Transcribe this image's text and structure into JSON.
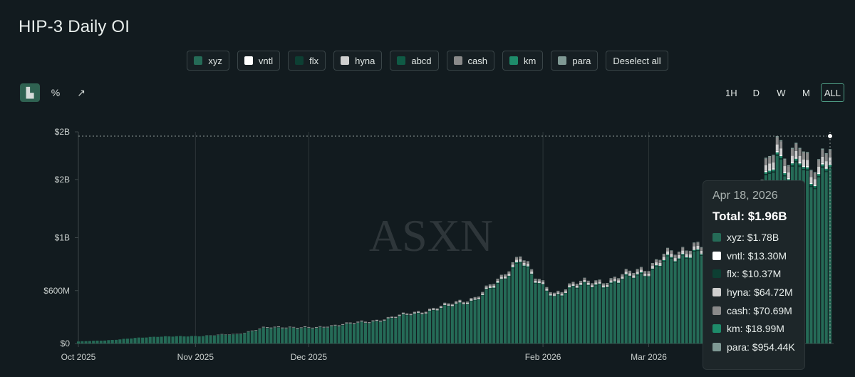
{
  "title": "HIP-3 Daily OI",
  "legend": [
    {
      "name": "xyz",
      "color": "#256b57"
    },
    {
      "name": "vntl",
      "color": "#ffffff"
    },
    {
      "name": "flx",
      "color": "#0d3f33"
    },
    {
      "name": "hyna",
      "color": "#cfcfcf"
    },
    {
      "name": "abcd",
      "color": "#0f5a45"
    },
    {
      "name": "cash",
      "color": "#8a8a8a"
    },
    {
      "name": "km",
      "color": "#1e8b6a"
    },
    {
      "name": "para",
      "color": "#7f9994"
    }
  ],
  "deselect_label": "Deselect all",
  "toolbar": [
    {
      "name": "bar-chart-icon",
      "glyph": "▙",
      "active": true
    },
    {
      "name": "percent-icon",
      "glyph": "%",
      "active": false
    },
    {
      "name": "line-chart-icon",
      "glyph": "↗",
      "active": false
    }
  ],
  "ranges": [
    {
      "label": "1H",
      "active": false
    },
    {
      "label": "D",
      "active": false
    },
    {
      "label": "W",
      "active": false
    },
    {
      "label": "M",
      "active": false
    },
    {
      "label": "ALL",
      "active": true
    }
  ],
  "watermark": "ASXN",
  "tooltip": {
    "date": "Apr 18, 2026",
    "total": "Total: $1.96B",
    "rows": [
      {
        "label": "xyz: $1.78B",
        "color": "#256b57"
      },
      {
        "label": "vntl: $13.30M",
        "color": "#ffffff"
      },
      {
        "label": "flx: $10.37M",
        "color": "#0d3f33"
      },
      {
        "label": "hyna: $64.72M",
        "color": "#cfcfcf"
      },
      {
        "label": "cash: $70.69M",
        "color": "#8a8a8a"
      },
      {
        "label": "km: $18.99M",
        "color": "#1e8b6a"
      },
      {
        "label": "para: $954.44K",
        "color": "#7f9994"
      }
    ]
  },
  "chart_data": {
    "type": "bar",
    "stacked": true,
    "y_ticks": [
      "$2B",
      "$2B",
      "$1B",
      "$600M",
      "$0"
    ],
    "x_ticks": [
      "Oct 2025",
      "Nov 2025",
      "Dec 2025",
      "Feb 2026",
      "Mar 2026"
    ],
    "x_range": [
      "2025-10-01",
      "2026-04-18"
    ],
    "ylim": [
      0,
      2.0
    ],
    "unit": "$B",
    "grid": "vertical month lines",
    "series_order": [
      "xyz",
      "flx",
      "km",
      "vntl",
      "hyna",
      "cash",
      "para"
    ],
    "dates": [
      "2025-10-01",
      "2025-10-08",
      "2025-10-15",
      "2025-10-22",
      "2025-10-29",
      "2025-11-05",
      "2025-11-12",
      "2025-11-19",
      "2025-11-26",
      "2025-12-03",
      "2025-12-10",
      "2025-12-17",
      "2025-12-24",
      "2025-12-31",
      "2026-01-07",
      "2026-01-14",
      "2026-01-21",
      "2026-01-26",
      "2026-01-30",
      "2026-02-04",
      "2026-02-09",
      "2026-02-14",
      "2026-02-19",
      "2026-02-24",
      "2026-03-01",
      "2026-03-05",
      "2026-03-09",
      "2026-03-13",
      "2026-03-17",
      "2026-03-20",
      "2026-03-23",
      "2026-03-26",
      "2026-03-29",
      "2026-04-01",
      "2026-04-04",
      "2026-04-07",
      "2026-04-10",
      "2026-04-13",
      "2026-04-16",
      "2026-04-18"
    ],
    "totals": [
      0.02,
      0.03,
      0.05,
      0.07,
      0.07,
      0.08,
      0.09,
      0.15,
      0.16,
      0.15,
      0.19,
      0.21,
      0.26,
      0.31,
      0.37,
      0.44,
      0.62,
      0.87,
      0.62,
      0.48,
      0.57,
      0.59,
      0.61,
      0.67,
      0.73,
      0.85,
      0.85,
      0.96,
      0.95,
      1.04,
      1.12,
      1.21,
      1.24,
      1.65,
      1.97,
      1.78,
      1.88,
      1.6,
      1.81,
      1.96
    ],
    "tooltip_breakdown_2026_04_18": {
      "xyz": 1.78,
      "vntl": 0.0133,
      "flx": 0.01037,
      "hyna": 0.06472,
      "cash": 0.07069,
      "km": 0.01899,
      "para": 0.00095444
    }
  }
}
